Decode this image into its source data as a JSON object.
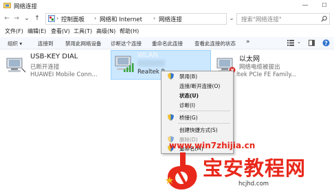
{
  "window": {
    "title": "网络连接",
    "minimize": "—",
    "maximize": "☐"
  },
  "nav": {
    "back": "←",
    "forward": "→",
    "up": "↑",
    "dropdown": "⌄"
  },
  "address": {
    "crumbs": [
      "控制面板",
      "网络和 Internet",
      "网络连接"
    ],
    "separator": "›"
  },
  "search": {
    "placeholder": "搜索\"网络连接\"",
    "icon": "search-icon"
  },
  "menubar": {
    "items": [
      "文件(F)",
      "编辑(E)",
      "查看(V)",
      "工具(T)",
      "高级(N)",
      "帮助(H)"
    ]
  },
  "cmdbar": {
    "items": [
      "组织 ▾",
      "连接到",
      "禁用此网络设备",
      "诊断这个连接",
      "重命名此连接",
      "查看此连接的状态"
    ],
    "overflow": "»"
  },
  "adapters": [
    {
      "name": "USB-KEY DIAL",
      "status": "已断开连接",
      "device": "HUAWEI Mobile Conn..."
    },
    {
      "name": "WLAN",
      "status": "",
      "device": "Realtek R"
    },
    {
      "name": "以太网",
      "status": "网络电缆被拔出",
      "device": "ltek PCIe FE Family..."
    }
  ],
  "context_menu": {
    "items": [
      {
        "label": "禁用(B)",
        "icon": "shield-icon"
      },
      {
        "label": "连接/断开连接(O)"
      },
      {
        "label": "状态(U)"
      },
      {
        "label": "诊断(I)"
      },
      {
        "label": "桥接(G)",
        "icon": "shield-icon"
      },
      {
        "label": "创建快捷方式(S)"
      },
      {
        "label": "删除(D)",
        "icon": "shield-icon"
      },
      {
        "label": "重命名(M)",
        "icon": "shield-icon"
      }
    ]
  },
  "watermark": {
    "url": "www.win7zhijia.cn",
    "brand": "宝安教程网",
    "domain": "hcjhd.com"
  },
  "colors": {
    "selection_bg": "#cce8ff",
    "watermark_red": "#e8281b"
  }
}
